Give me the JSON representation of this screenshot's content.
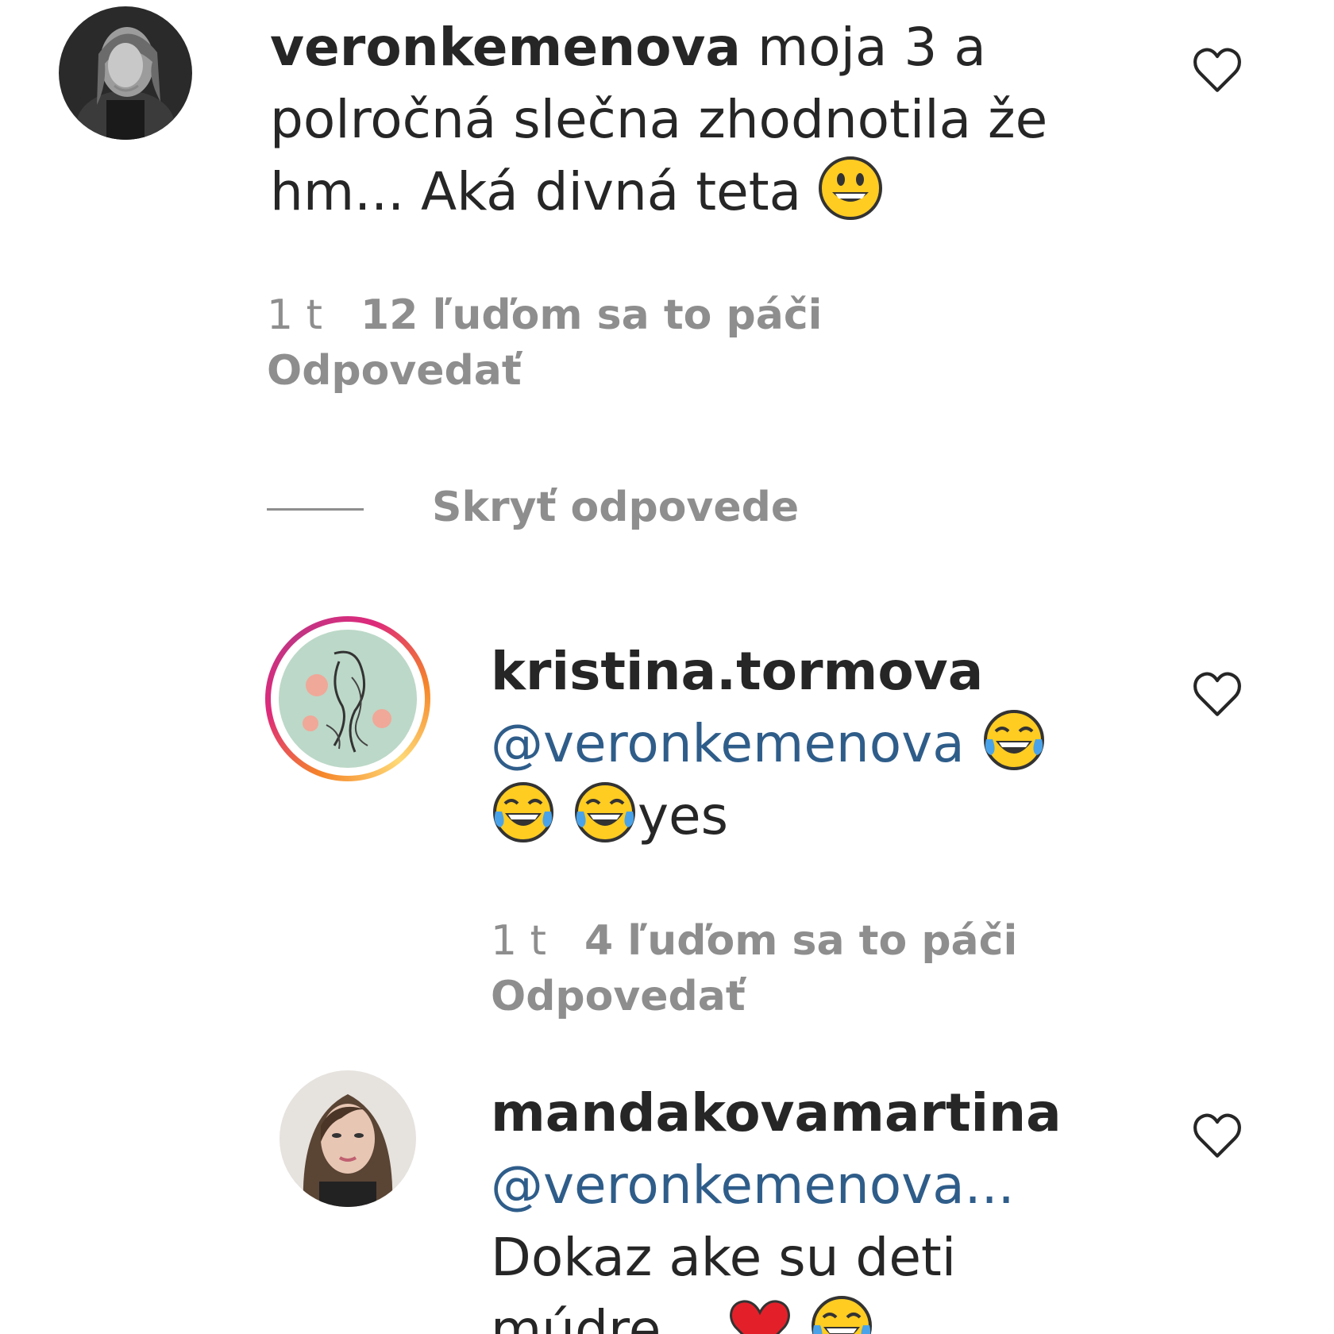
{
  "comments": [
    {
      "username": "veronkemenova",
      "text_line1": " moja 3 a",
      "text_line2": "polročná slečna zhodnotila že",
      "text_line3": "hm... Aká divná teta ",
      "emoji": "grinning-face",
      "time": "1 t",
      "likes": "12 ľuďom sa to páči",
      "reply": "Odpovedať"
    }
  ],
  "hide_replies": "Skryť odpovede",
  "replies": [
    {
      "username": "kristina.tormova",
      "mention": "@veronkemenova",
      "text_after": "yes",
      "emojis": [
        "tears-of-joy",
        "tears-of-joy",
        "tears-of-joy"
      ],
      "time": "1 t",
      "likes": "4 ľuďom sa to páči",
      "reply": "Odpovedať"
    },
    {
      "username": "mandakovamartina",
      "mention": "@veronkemenova...",
      "text_line": "Dokaz ake su deti",
      "text_partial": "múdre...",
      "emojis": [
        "red-heart",
        "tears-of-joy"
      ]
    }
  ]
}
